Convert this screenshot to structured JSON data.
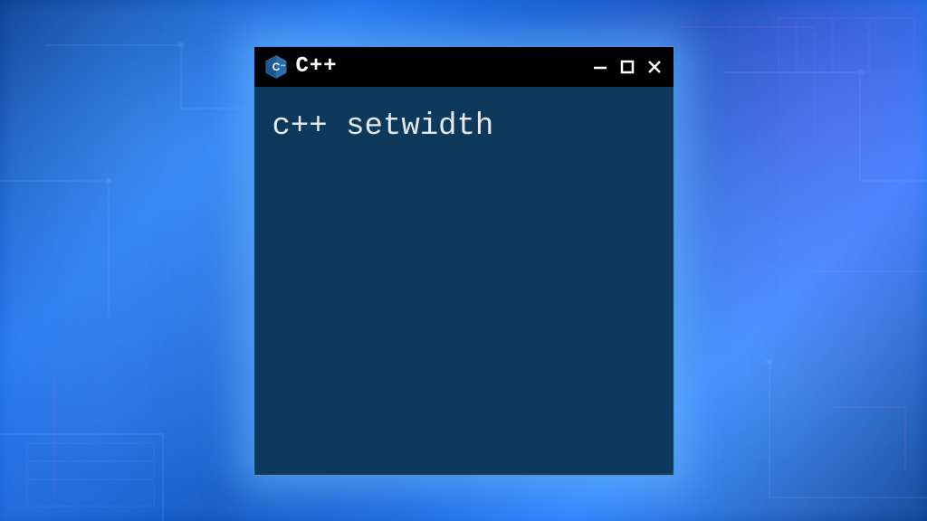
{
  "window": {
    "title": "C++",
    "icon_name": "cpp-logo-icon"
  },
  "content": {
    "text": "c++ setwidth"
  },
  "controls": {
    "minimize_symbol": "—",
    "maximize_symbol": "□",
    "close_symbol": "✕"
  },
  "colors": {
    "window_bg": "#0d3a5c",
    "titlebar_bg": "#000000",
    "text_color": "#e8e8e8",
    "glow": "#4a90d9"
  }
}
